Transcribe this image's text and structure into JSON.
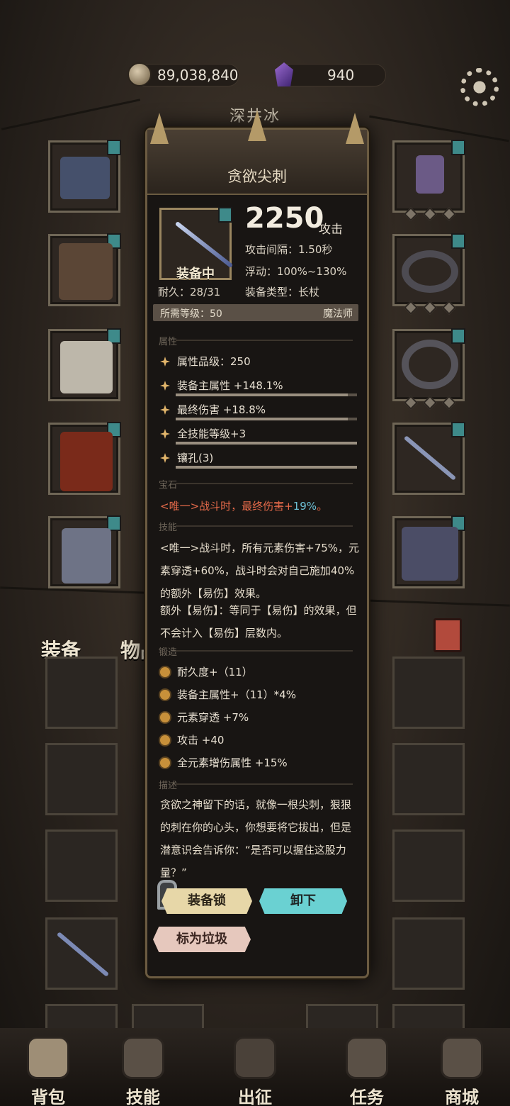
{
  "currency": {
    "gold": "89,038,840",
    "gems": "940"
  },
  "character_name": "深井冰",
  "tabs": {
    "equip": "装备",
    "items": "物品"
  },
  "item": {
    "name": "贪欲尖刺",
    "equipped_label": "装备中",
    "attack": "2250",
    "attack_label": "攻击",
    "attack_interval": "攻击间隔：1.50秒",
    "fluctuation": "浮动：100%~130%",
    "durability": "耐久：28/31",
    "equip_type": "装备类型：长杖",
    "required_level": "所需等级：50",
    "class": "魔法师",
    "section_attributes": "属性",
    "attributes": [
      {
        "text": "属性品级：250",
        "fill": 0
      },
      {
        "text": "装备主属性 +148.1%",
        "fill": 0.95
      },
      {
        "text": "最终伤害 +18.8%",
        "fill": 0.95
      },
      {
        "text": "全技能等级+3",
        "fill": 1
      },
      {
        "text": "镶孔(3)",
        "fill": 1
      }
    ],
    "section_gem": "宝石",
    "gem_text": "<唯一>战斗时，最终伤害+",
    "gem_value": "19%",
    "gem_end": "。",
    "section_skill": "技能",
    "skill_text": "<唯一>战斗时，所有元素伤害+75%，元素穿透+60%，战斗时会对自己施加40%的额外【易伤】效果。",
    "skill_text2": "额外【易伤】：等同于【易伤】的效果，但不会计入【易伤】层数内。",
    "section_forge": "锻造",
    "forge": [
      "耐久度+（11）",
      "装备主属性+（11）*4%",
      "元素穿透 +7%",
      "攻击 +40",
      "全元素增伤属性 +15%"
    ],
    "section_desc": "描述",
    "description": "贪欲之神留下的话，就像一根尖刺，狠狠的刺在你的心头，你想要将它拔出，但是潜意识会告诉你：“是否可以握住这股力量？”",
    "btn_lock": "装备锁",
    "btn_unequip": "卸下",
    "btn_trash": "标为垃圾"
  },
  "nav": [
    "背包",
    "技能",
    "出征",
    "任务",
    "商城"
  ]
}
